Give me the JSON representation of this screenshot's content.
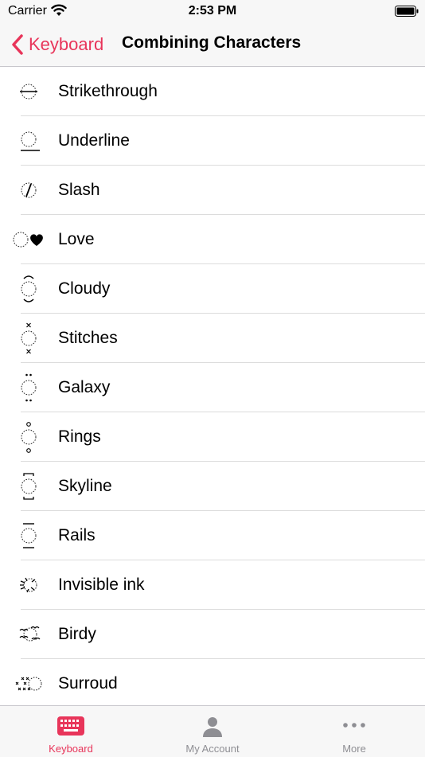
{
  "status_bar": {
    "carrier": "Carrier",
    "time": "2:53 PM"
  },
  "nav": {
    "back_label": "Keyboard",
    "title": "Combining Characters"
  },
  "accent_color": "#e8355a",
  "items": [
    {
      "label": "Strikethrough",
      "icon": "strikethrough-icon"
    },
    {
      "label": "Underline",
      "icon": "underline-icon"
    },
    {
      "label": "Slash",
      "icon": "slash-icon"
    },
    {
      "label": "Love",
      "icon": "love-icon"
    },
    {
      "label": "Cloudy",
      "icon": "cloudy-icon"
    },
    {
      "label": "Stitches",
      "icon": "stitches-icon"
    },
    {
      "label": "Galaxy",
      "icon": "galaxy-icon"
    },
    {
      "label": "Rings",
      "icon": "rings-icon"
    },
    {
      "label": "Skyline",
      "icon": "skyline-icon"
    },
    {
      "label": "Rails",
      "icon": "rails-icon"
    },
    {
      "label": "Invisible ink",
      "icon": "invisible-ink-icon"
    },
    {
      "label": "Birdy",
      "icon": "birdy-icon"
    },
    {
      "label": "Surroud",
      "icon": "surround-icon"
    }
  ],
  "tabs": [
    {
      "label": "Keyboard",
      "icon": "keyboard-icon",
      "active": true
    },
    {
      "label": "My Account",
      "icon": "person-icon",
      "active": false
    },
    {
      "label": "More",
      "icon": "more-icon",
      "active": false
    }
  ]
}
